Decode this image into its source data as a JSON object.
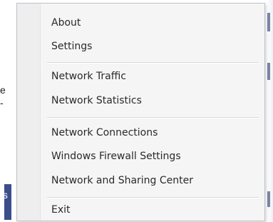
{
  "background": {
    "left_fragments": [
      "e",
      "-",
      "ts"
    ],
    "deco_text": ""
  },
  "menu": {
    "items": [
      {
        "label": "About"
      },
      {
        "label": "Settings"
      },
      {
        "label": "Network Traffic"
      },
      {
        "label": "Network Statistics"
      },
      {
        "label": "Network Connections"
      },
      {
        "label": "Windows Firewall Settings"
      },
      {
        "label": "Network and Sharing Center"
      },
      {
        "label": "Exit"
      }
    ]
  }
}
